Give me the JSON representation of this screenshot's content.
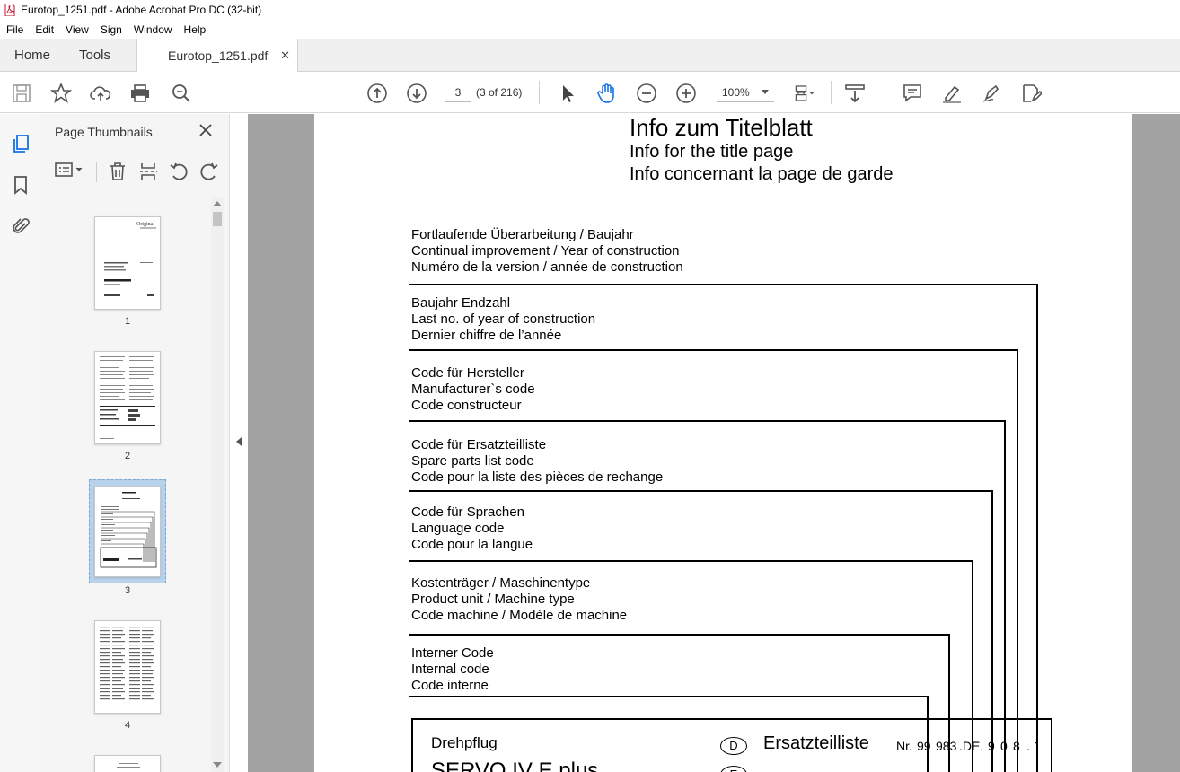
{
  "window": {
    "title": "Eurotop_1251.pdf - Adobe Acrobat Pro DC (32-bit)"
  },
  "menu": [
    "File",
    "Edit",
    "View",
    "Sign",
    "Window",
    "Help"
  ],
  "tabs": {
    "home": "Home",
    "tools": "Tools",
    "doc": "Eurotop_1251.pdf"
  },
  "toolbar": {
    "page_value": "3",
    "page_count": "(3 of 216)",
    "zoom": "100%"
  },
  "panel": {
    "title": "Page Thumbnails",
    "thumbnails": [
      {
        "label": "1"
      },
      {
        "label": "2"
      },
      {
        "label": "3"
      },
      {
        "label": "4"
      }
    ],
    "selected_page": 3
  },
  "page": {
    "heading_de": "Info  zum  Titelblatt",
    "heading_en": "Info for the title page",
    "heading_fr": "Info concernant la page de garde",
    "blocks": [
      {
        "de": "Fortlaufende Überarbeitung / Baujahr",
        "en": "Continual improvement / Year of construction",
        "fr": "Numéro de la version / année de construction"
      },
      {
        "de": "Baujahr Endzahl",
        "en": "Last no. of year of construction",
        "fr": "Dernier chiffre de l’année"
      },
      {
        "de": "Code für Hersteller",
        "en": "Manufacturer`s  code",
        "fr": "Code constructeur"
      },
      {
        "de": "Code für Ersatzteilliste",
        "en": "Spare parts list code",
        "fr": "Code pour la liste des pièces de rechange"
      },
      {
        "de": "Code für Sprachen",
        "en": "Language code",
        "fr": "Code pour la langue"
      },
      {
        "de": "Kostenträger / Maschinentype",
        "en": "Product unit / Machine type",
        "fr": "Code machine / Modèle de machine"
      },
      {
        "de": "Interner Code",
        "en": "Internal code",
        "fr": "Code interne"
      }
    ],
    "box": {
      "product_type": "Drehpflug",
      "product_name": "SERVO IV E plus",
      "lang_d": "D",
      "lang_e": "E",
      "doc_title_de": "Ersatzteilliste",
      "number_label": "Nr.",
      "number_parts": [
        "99",
        "983",
        ".DE.",
        "9",
        "0",
        "8",
        ". 1"
      ]
    }
  },
  "colors": {
    "accent": "#1473e6",
    "doc_bg": "#a3a3a3",
    "panel_bg": "#f5f5f5"
  }
}
